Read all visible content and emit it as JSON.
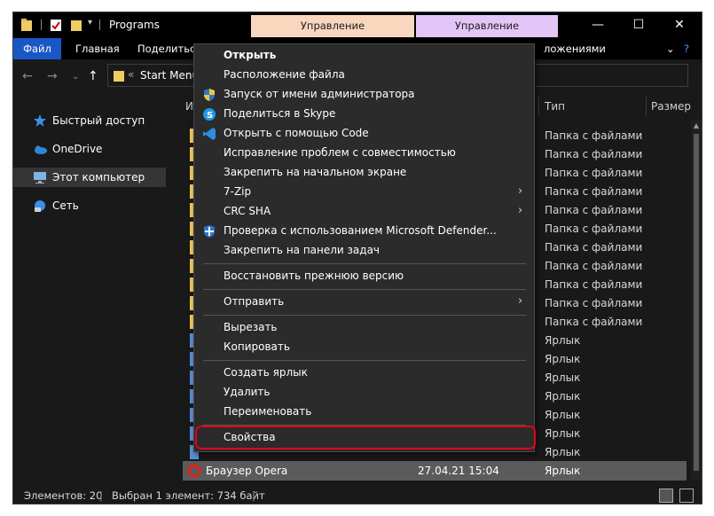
{
  "titlebar": {
    "title": "Programs",
    "context_tab_1": "Управление",
    "context_tab_2": "Управление",
    "minimize": "—",
    "maximize": "☐",
    "close": "✕"
  },
  "ribbon": {
    "file": "Файл",
    "home": "Главная",
    "share": "Поделиться",
    "apps": "ложениями",
    "expand": "⌄",
    "help": "?"
  },
  "address": {
    "prefix": "«",
    "path": "Start Menu"
  },
  "sidebar": {
    "items": [
      {
        "label": "Быстрый доступ",
        "icon": "star-icon"
      },
      {
        "label": "OneDrive",
        "icon": "cloud-icon"
      },
      {
        "label": "Этот компьютер",
        "icon": "computer-icon"
      },
      {
        "label": "Сеть",
        "icon": "network-icon"
      }
    ]
  },
  "columns": {
    "name": "И",
    "type": "Тип",
    "size": "Размер"
  },
  "rows": [
    {
      "type": "Папка с файлами"
    },
    {
      "type": "Папка с файлами"
    },
    {
      "type": "Папка с файлами"
    },
    {
      "type": "Папка с файлами"
    },
    {
      "type": "Папка с файлами"
    },
    {
      "type": "Папка с файлами"
    },
    {
      "type": "Папка с файлами"
    },
    {
      "type": "Папка с файлами"
    },
    {
      "type": "Папка с файлами"
    },
    {
      "type": "Папка с файлами"
    },
    {
      "type": "Папка с файлами"
    },
    {
      "type": "Ярлык"
    },
    {
      "type": "Ярлык"
    },
    {
      "type": "Ярлык"
    },
    {
      "type": "Ярлык"
    },
    {
      "type": "Ярлык"
    },
    {
      "type": "Ярлык"
    },
    {
      "type": "Ярлык"
    }
  ],
  "selected_row": {
    "name": "Браузер Opera",
    "date": "27.04.21 15:04",
    "type": "Ярлык"
  },
  "context_menu": {
    "open": "Открыть",
    "file_location": "Расположение файла",
    "run_as_admin": "Запуск от имени администратора",
    "share_skype": "Поделиться в Skype",
    "open_with_code": "Открыть с помощью Code",
    "compat": "Исправление проблем с совместимостью",
    "pin_start": "Закрепить на начальном экране",
    "zip": "7-Zip",
    "crc": "CRC SHA",
    "defender": "Проверка с использованием Microsoft Defender...",
    "pin_taskbar": "Закрепить на панели задач",
    "restore": "Восстановить прежнюю версию",
    "send_to": "Отправить",
    "cut": "Вырезать",
    "copy": "Копировать",
    "create_shortcut": "Создать ярлык",
    "delete": "Удалить",
    "rename": "Переименовать",
    "properties": "Свойства"
  },
  "status": {
    "items_count": "Элементов: 20",
    "selected": "Выбран 1 элемент: 734 байт"
  },
  "colors": {
    "accent": "#1a57c6",
    "highlight": "#e2001a"
  }
}
